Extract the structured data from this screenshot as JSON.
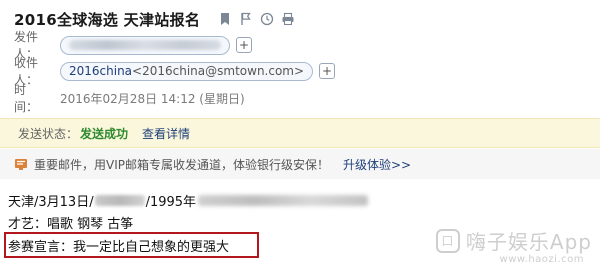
{
  "email": {
    "subject": "2016全球海选 天津站报名",
    "sender_label": "发件人：",
    "recipient_label": "收件人：",
    "recipient_name": "2016china",
    "recipient_email": "<2016china@smtown.com>",
    "time_label": "时　间：",
    "time_value": "2016年02月28日 14:12 (星期日)",
    "add_symbol": "+"
  },
  "status": {
    "label": "发送状态：",
    "value": "发送成功",
    "details_link": "查看详情"
  },
  "promo": {
    "text": "重要邮件，用VIP邮箱专属收发通道，体验银行级安保！",
    "link": "升级体验>>"
  },
  "body": {
    "line1_a": "天津/3月13日/",
    "line1_b": "/1995年",
    "line2": "才艺：唱歌 钢琴 古筝",
    "line3": "参赛宣言：我一定比自己想象的更强大"
  },
  "watermark": {
    "logo_char": "口",
    "text": "嗨子娱乐App",
    "sub": "www.haozi.com"
  },
  "colors": {
    "status_success": "#2e8a2e",
    "link": "#1f3f7a",
    "highlight_border": "#b3161d",
    "status_bg": "#fbf7dc"
  }
}
